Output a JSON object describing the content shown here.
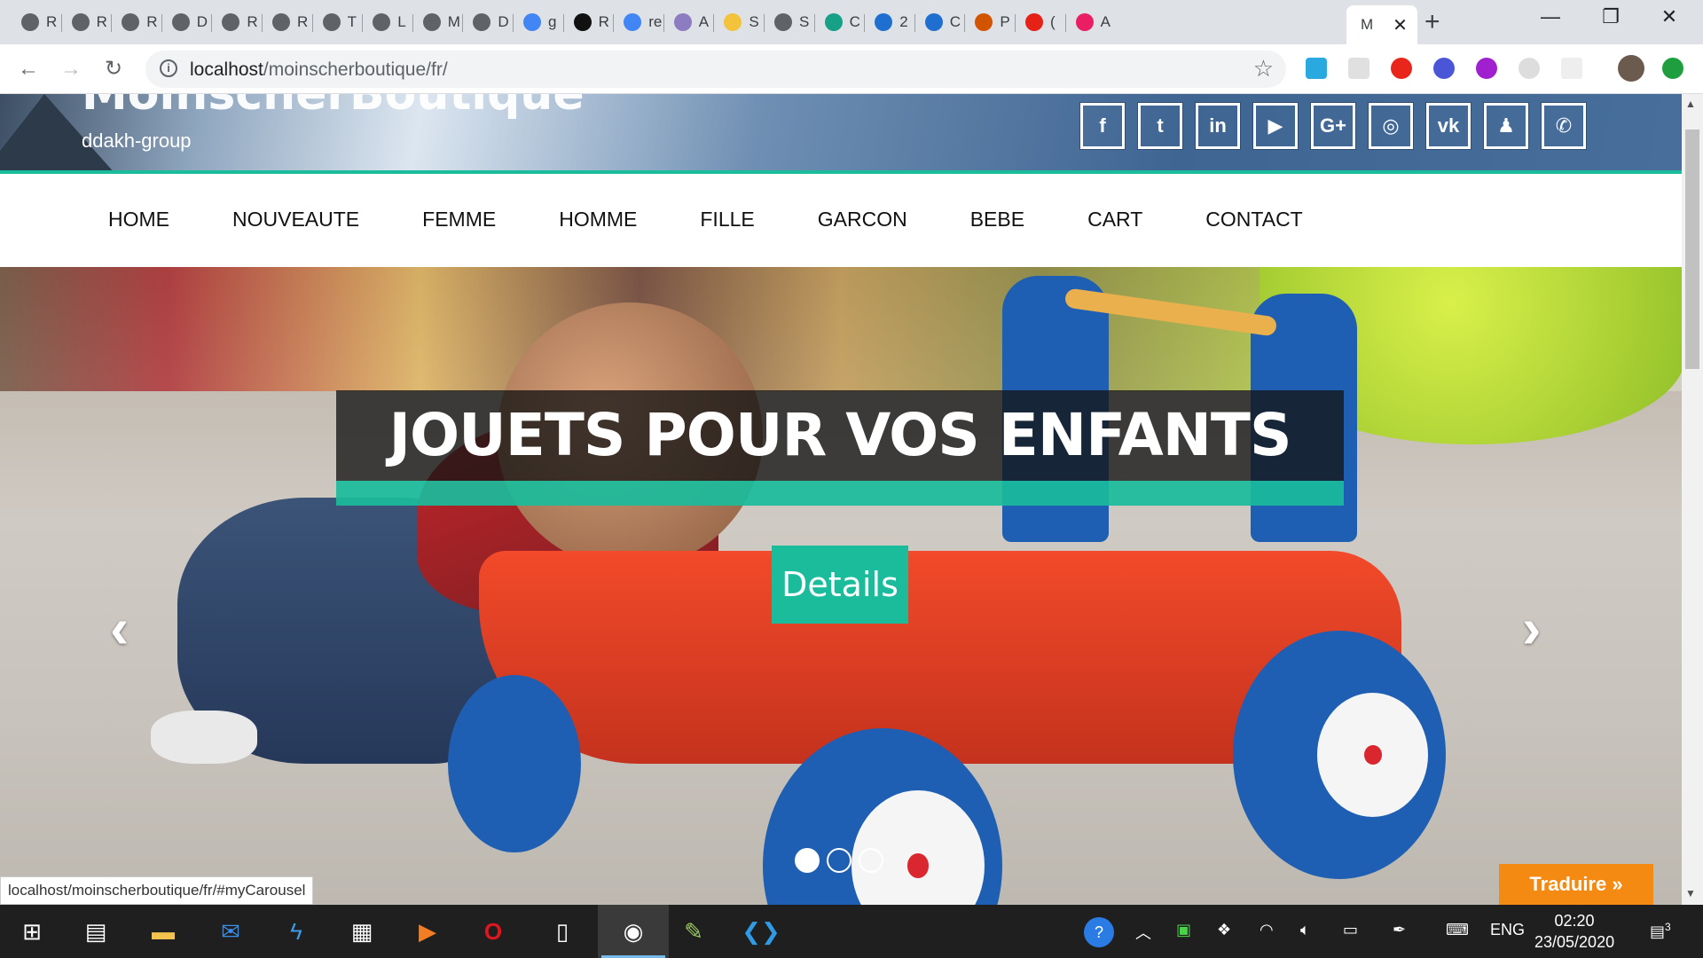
{
  "browser": {
    "tabs": [
      {
        "letter": "R",
        "icon": "globe-icon",
        "color": "#5f6368"
      },
      {
        "letter": "R",
        "icon": "globe-icon",
        "color": "#5f6368"
      },
      {
        "letter": "R",
        "icon": "globe-icon",
        "color": "#5f6368"
      },
      {
        "letter": "D",
        "icon": "globe-icon",
        "color": "#5f6368"
      },
      {
        "letter": "R",
        "icon": "globe-icon",
        "color": "#5f6368"
      },
      {
        "letter": "R",
        "icon": "globe-icon",
        "color": "#5f6368"
      },
      {
        "letter": "T",
        "icon": "globe-icon",
        "color": "#5f6368"
      },
      {
        "letter": "L",
        "icon": "globe-icon",
        "color": "#5f6368"
      },
      {
        "letter": "M",
        "icon": "globe-icon",
        "color": "#5f6368"
      },
      {
        "letter": "D",
        "icon": "globe-icon",
        "color": "#5f6368"
      },
      {
        "letter": "g",
        "icon": "google-icon",
        "color": "#4285f4"
      },
      {
        "letter": "R",
        "icon": "codepen-icon",
        "color": "#111111"
      },
      {
        "letter": "re",
        "icon": "google-icon",
        "color": "#4285f4"
      },
      {
        "letter": "A",
        "icon": "figma-like-icon",
        "color": "#8e7cc3"
      },
      {
        "letter": "S",
        "icon": "shield-icon",
        "color": "#f2c33b"
      },
      {
        "letter": "S",
        "icon": "globe-icon",
        "color": "#5f6368"
      },
      {
        "letter": "C",
        "icon": "diamond-icon",
        "color": "#16a085"
      },
      {
        "letter": "2",
        "icon": "chat-icon",
        "color": "#1f6fd1"
      },
      {
        "letter": "C",
        "icon": "chat-icon",
        "color": "#1f6fd1"
      },
      {
        "letter": "P",
        "icon": "a-icon",
        "color": "#d35400"
      },
      {
        "letter": "(",
        "icon": "youtube-icon",
        "color": "#e62117"
      },
      {
        "letter": "A",
        "icon": "w-icon",
        "color": "#e91e63"
      }
    ],
    "active_tab": {
      "letter": "M"
    },
    "url_host": "localhost",
    "url_path": "/moinscherboutique/fr/"
  },
  "site": {
    "title": "MoinscherBoutique",
    "tagline": "ddakh-group",
    "socials": [
      {
        "label": "f",
        "icon": "facebook-icon"
      },
      {
        "label": "t",
        "icon": "twitter-icon"
      },
      {
        "label": "in",
        "icon": "linkedin-icon"
      },
      {
        "label": "▶",
        "icon": "youtube-icon"
      },
      {
        "label": "G+",
        "icon": "google-plus-icon"
      },
      {
        "label": "◎",
        "icon": "instagram-icon"
      },
      {
        "label": "vk",
        "icon": "vk-icon"
      },
      {
        "label": "♟",
        "icon": "snapchat-icon"
      },
      {
        "label": "✆",
        "icon": "whatsapp-icon"
      }
    ],
    "nav": [
      "HOME",
      "NOUVEAUTE",
      "FEMME",
      "HOMME",
      "FILLE",
      "GARCON",
      "BEBE",
      "CART",
      "CONTACT"
    ]
  },
  "carousel": {
    "caption": "JOUETS POUR VOS ENFANTS",
    "button": "Details",
    "prev": "‹",
    "next": "›",
    "indicator_count": 3,
    "active_index": 0,
    "accent": "#1abc9c"
  },
  "status_url": "localhost/moinscherboutique/fr/#myCarousel",
  "translate_label": "Traduire »",
  "taskbar": {
    "language": "ENG",
    "time": "02:20",
    "date": "23/05/2020",
    "notifications": "3"
  }
}
